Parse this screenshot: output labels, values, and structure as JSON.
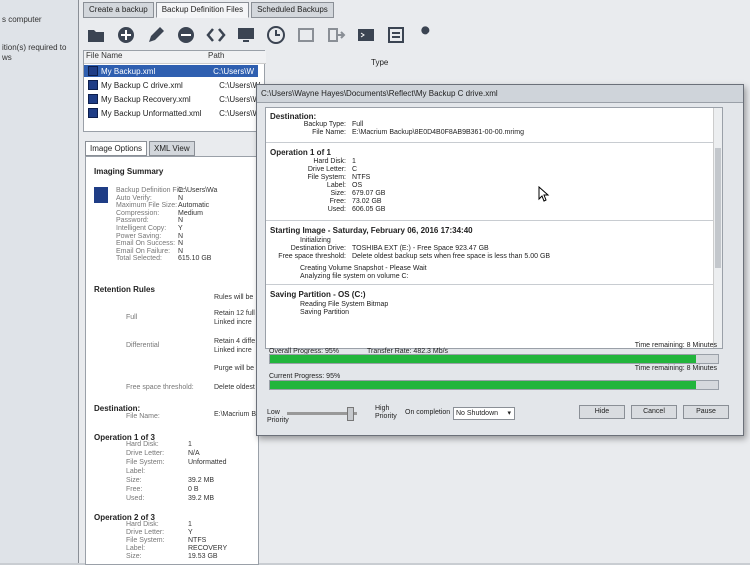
{
  "left_strip": {
    "line1": "s computer",
    "line2": "ition(s) required to",
    "line3": "ws"
  },
  "tabs": [
    "Create a backup",
    "Backup Definition Files",
    "Scheduled Backups"
  ],
  "file_list": {
    "col_name": "File Name",
    "col_path": "Path",
    "col_type": "Type",
    "rows": [
      {
        "name": "My Backup.xml",
        "path": "C:\\Users\\W"
      },
      {
        "name": "My Backup C drive.xml",
        "path": "C:\\Users\\W"
      },
      {
        "name": "My Backup Recovery.xml",
        "path": "C:\\Users\\W"
      },
      {
        "name": "My Backup Unformatted.xml",
        "path": "C:\\Users\\W"
      }
    ]
  },
  "subtabs": [
    "Image Options",
    "XML View"
  ],
  "left_panel": {
    "imaging_summary": "Imaging Summary",
    "summary": [
      {
        "k": "Backup Definition File:",
        "v": "C:\\Users\\Wa"
      },
      {
        "k": "Auto Verify:",
        "v": "N"
      },
      {
        "k": "Maximum File Size:",
        "v": "Automatic"
      },
      {
        "k": "Compression:",
        "v": "Medium"
      },
      {
        "k": "Password:",
        "v": "N"
      },
      {
        "k": "Intelligent Copy:",
        "v": "Y"
      },
      {
        "k": "Power Saving:",
        "v": "N"
      },
      {
        "k": "Email On Success:",
        "v": "N"
      },
      {
        "k": "Email On Failure:",
        "v": "N"
      },
      {
        "k": "Total Selected:",
        "v": "615.10 GB"
      }
    ],
    "retention_rules": "Retention Rules",
    "rules_line": "Rules will be",
    "full_label": "Full",
    "full_v1": "Retain 12 full",
    "full_v2": "Linked incre",
    "diff_label": "Differential",
    "diff_v1": "Retain 4 diffe",
    "diff_v2": "Linked incre",
    "purge": "Purge will be",
    "free_thr": "Free space threshold:",
    "free_thr_v": "Delete oldest",
    "destination": "Destination:",
    "file_name_k": "File Name:",
    "file_name_v": "E:\\Macrium B",
    "op1": "Operation 1 of 3",
    "op1_rows": [
      {
        "k": "Hard Disk:",
        "v": "1"
      },
      {
        "k": "Drive Letter:",
        "v": "N/A"
      },
      {
        "k": "File System:",
        "v": "Unformatted"
      },
      {
        "k": "Label:",
        "v": ""
      },
      {
        "k": "Size:",
        "v": "39.2 MB"
      },
      {
        "k": "Free:",
        "v": "0 B"
      },
      {
        "k": "Used:",
        "v": "39.2 MB"
      }
    ],
    "op2": "Operation 2 of 3",
    "op2_rows": [
      {
        "k": "Hard Disk:",
        "v": "1"
      },
      {
        "k": "Drive Letter:",
        "v": "Y"
      },
      {
        "k": "File System:",
        "v": "NTFS"
      },
      {
        "k": "Label:",
        "v": "RECOVERY"
      },
      {
        "k": "Size:",
        "v": "19.53 GB"
      }
    ]
  },
  "dialog": {
    "title": "C:\\Users\\Wayne Hayes\\Documents\\Reflect\\My Backup C drive.xml",
    "destination": "Destination:",
    "backup_type_k": "Backup Type:",
    "backup_type_v": "Full",
    "file_name_k": "File Name:",
    "file_name_v": "E:\\Macrium Backup\\8E0D4B0F8AB9B361-00-00.mrimg",
    "operation": "Operation 1 of 1",
    "op_rows": [
      {
        "k": "Hard Disk:",
        "v": "1"
      },
      {
        "k": "Drive Letter:",
        "v": "C"
      },
      {
        "k": "File System:",
        "v": "NTFS"
      },
      {
        "k": "Label:",
        "v": "OS"
      },
      {
        "k": "Size:",
        "v": "679.07 GB"
      },
      {
        "k": "Free:",
        "v": "73.02 GB"
      },
      {
        "k": "Used:",
        "v": "606.05 GB"
      }
    ],
    "starting": "Starting Image - Saturday, February 06, 2016 17:34:40",
    "initializing": "Initializing",
    "dest_drive_k": "Destination Drive:",
    "dest_drive_v": "TOSHIBA EXT (E:) - Free Space 923.47 GB",
    "free_thr_k": "Free space threshold:",
    "free_thr_v": "Delete oldest backup sets when free space is less than 5.00 GB",
    "vss": "Creating Volume Snapshot - Please Wait",
    "analyzing": "Analyzing file system on volume C:",
    "saving": "Saving Partition - OS (C:)",
    "reading": "Reading File System Bitmap",
    "saving_partition": "Saving Partition",
    "overall_label": "Overall Progress: 95%",
    "transfer_rate": "Transfer Rate: 482.3 Mb/s",
    "overall_remaining": "Time remaining: 8 Minutes",
    "current_label": "Current Progress: 95%",
    "current_remaining": "Time remaining: 8 Minutes",
    "overall_progress": 95,
    "current_progress": 95,
    "low_priority": "Low Priority",
    "high_priority": "High Priority",
    "on_completion": "On completion",
    "completion_value": "No Shutdown",
    "hide": "Hide",
    "cancel": "Cancel",
    "pause": "Pause"
  }
}
